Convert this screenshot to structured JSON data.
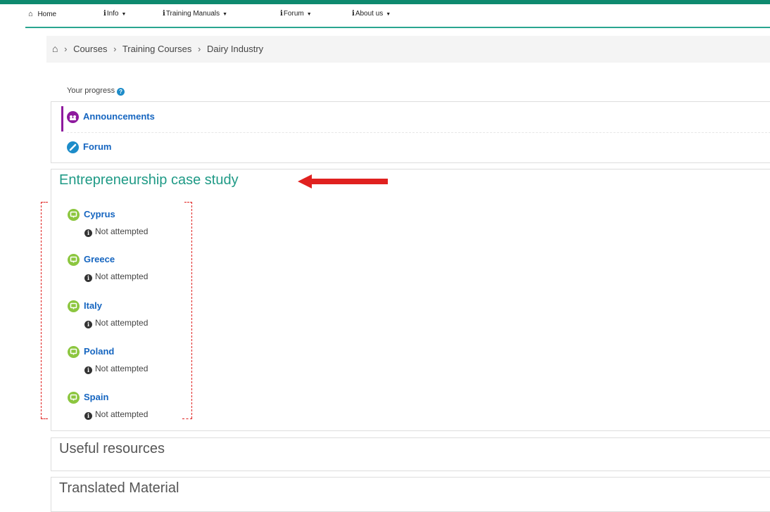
{
  "nav": {
    "items": [
      {
        "icon": "home-icon",
        "label": "Home",
        "dropdown": false
      },
      {
        "icon": "info-icon",
        "label": "Info",
        "dropdown": true
      },
      {
        "icon": "info-icon",
        "label": "Training Manuals",
        "dropdown": true
      },
      {
        "icon": "info-icon",
        "label": "Forum",
        "dropdown": true
      },
      {
        "icon": "info-icon",
        "label": "About us",
        "dropdown": true
      }
    ]
  },
  "breadcrumb": {
    "items": [
      "Courses",
      "Training Courses",
      "Dairy Industry"
    ]
  },
  "progress": {
    "label": "Your progress"
  },
  "top_section": {
    "announcements": "Announcements",
    "forum": "Forum"
  },
  "case_study": {
    "title": "Entrepreneurship case study",
    "activities": [
      {
        "name": "Cyprus",
        "status": "Not attempted"
      },
      {
        "name": "Greece",
        "status": "Not attempted"
      },
      {
        "name": "Italy",
        "status": "Not attempted"
      },
      {
        "name": "Poland",
        "status": "Not attempted"
      },
      {
        "name": "Spain",
        "status": "Not attempted"
      }
    ]
  },
  "sections": {
    "useful": "Useful resources",
    "translated": "Translated Material"
  },
  "colors": {
    "accent": "#0f8a6f",
    "section_title": "#1f9a86",
    "link": "#1565c0",
    "activity_icon": "#8cc63f",
    "announcement_icon": "#8e1a9e",
    "forum_icon": "#1d8cc9",
    "annotation": "#e0211f"
  }
}
